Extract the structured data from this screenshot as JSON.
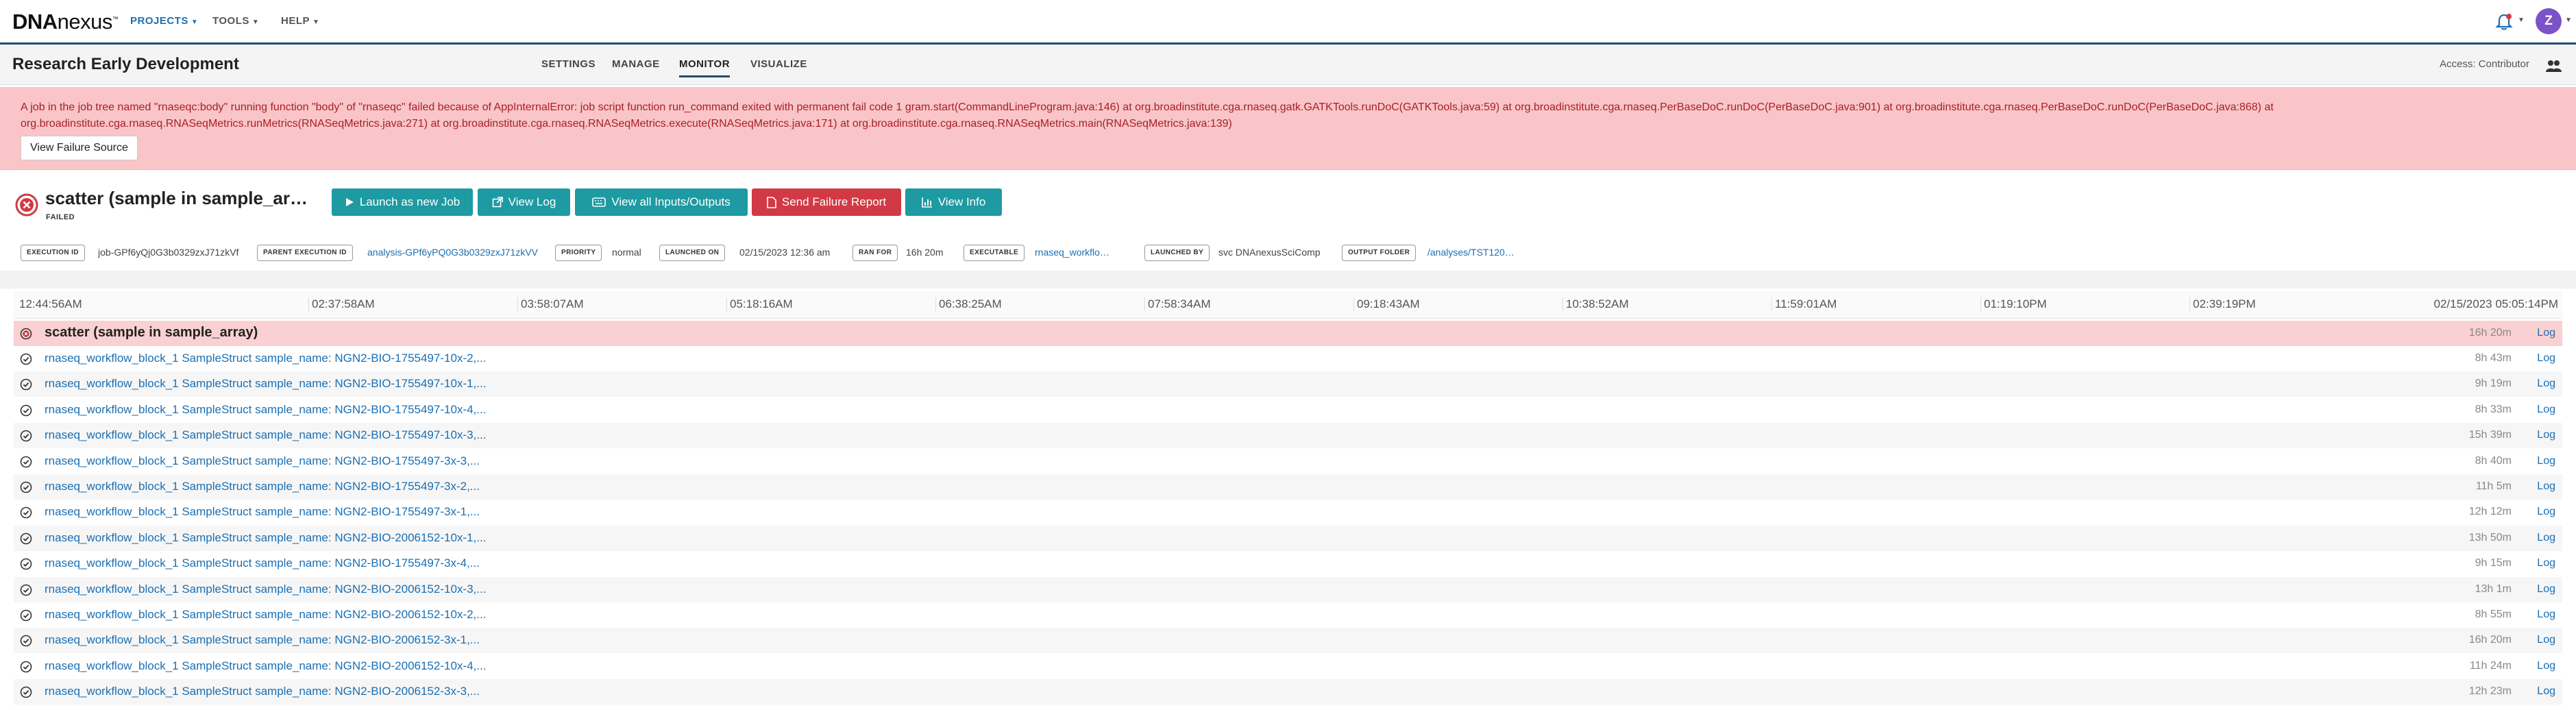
{
  "brand": {
    "logo_main": "DNA",
    "logo_rest": "nexus"
  },
  "nav": {
    "menus": [
      {
        "label": "PROJECTS",
        "active": true
      },
      {
        "label": "TOOLS",
        "active": false
      },
      {
        "label": "HELP",
        "active": false
      }
    ],
    "avatar_initial": "Z",
    "accent": "#1a6fb3"
  },
  "project": {
    "title": "Research Early Development",
    "tabs": [
      {
        "label": "SETTINGS"
      },
      {
        "label": "MANAGE"
      },
      {
        "label": "MONITOR",
        "active": true
      },
      {
        "label": "VISUALIZE"
      }
    ],
    "access": "Access: Contributor"
  },
  "error": {
    "message": "A job in the job tree named \"rnaseqc:body\" running function \"body\" of \"rnaseqc\" failed because of AppInternalError: job script function run_command exited with permanent fail code 1 gram.start(CommandLineProgram.java:146) at org.broadinstitute.cga.rnaseq.gatk.GATKTools.runDoC(GATKTools.java:59) at org.broadinstitute.cga.rnaseq.PerBaseDoC.runDoC(PerBaseDoC.java:901) at org.broadinstitute.cga.rnaseq.PerBaseDoC.runDoC(PerBaseDoC.java:868) at org.broadinstitute.cga.rnaseq.RNASeqMetrics.runMetrics(RNASeqMetrics.java:271) at org.broadinstitute.cga.rnaseq.RNASeqMetrics.execute(RNASeqMetrics.java:171) at org.broadinstitute.cga.rnaseq.RNASeqMetrics.main(RNASeqMetrics.java:139)",
    "button": "View Failure Source",
    "color": "#a81f26"
  },
  "job": {
    "name": "scatter (sample in sample_ar…",
    "status": "FAILED",
    "status_color": "#d13a44"
  },
  "actions": {
    "launch": "Launch as new Job",
    "view_log": "View Log",
    "view_io": "View all Inputs/Outputs",
    "send_report": "Send Failure Report",
    "view_info": "View Info"
  },
  "meta": [
    {
      "label": "EXECUTION ID",
      "value": "job-GPf6yQj0G3b0329zxJ71zkVf"
    },
    {
      "label": "PARENT EXECUTION ID",
      "value": "analysis-GPf6yPQ0G3b0329zxJ71zkVV"
    },
    {
      "label": "PRIORITY",
      "value": "normal"
    },
    {
      "label": "LAUNCHED ON",
      "value": "02/15/2023 12:36 am"
    },
    {
      "label": "RAN FOR",
      "value": "16h 20m"
    },
    {
      "label": "EXECUTABLE",
      "value": "rnaseq_workflo…"
    },
    {
      "label": "LAUNCHED BY",
      "value": "svc DNAnexusSciComp"
    },
    {
      "label": "OUTPUT FOLDER",
      "value": "/analyses/TST120…"
    }
  ],
  "timeline": {
    "ticks": [
      "12:44:56AM",
      "02:37:58AM",
      "03:58:07AM",
      "05:18:16AM",
      "06:38:25AM",
      "07:58:34AM",
      "09:18:43AM",
      "10:38:52AM",
      "11:59:01AM",
      "01:19:10PM",
      "02:39:19PM",
      "02/15/2023 05:05:14PM"
    ]
  },
  "parent_row": {
    "label": "scatter (sample in sample_array)",
    "duration": "16h 20m",
    "log": "Log"
  },
  "rows": [
    {
      "label": "rnaseq_workflow_block_1 SampleStruct sample_name: NGN2-BIO-1755497-10x-2,...",
      "duration": "8h 43m",
      "log": "Log"
    },
    {
      "label": "rnaseq_workflow_block_1 SampleStruct sample_name: NGN2-BIO-1755497-10x-1,...",
      "duration": "9h 19m",
      "log": "Log"
    },
    {
      "label": "rnaseq_workflow_block_1 SampleStruct sample_name: NGN2-BIO-1755497-10x-4,...",
      "duration": "8h 33m",
      "log": "Log"
    },
    {
      "label": "rnaseq_workflow_block_1 SampleStruct sample_name: NGN2-BIO-1755497-10x-3,...",
      "duration": "15h 39m",
      "log": "Log"
    },
    {
      "label": "rnaseq_workflow_block_1 SampleStruct sample_name: NGN2-BIO-1755497-3x-3,...",
      "duration": "8h 40m",
      "log": "Log"
    },
    {
      "label": "rnaseq_workflow_block_1 SampleStruct sample_name: NGN2-BIO-1755497-3x-2,...",
      "duration": "11h 5m",
      "log": "Log"
    },
    {
      "label": "rnaseq_workflow_block_1 SampleStruct sample_name: NGN2-BIO-1755497-3x-1,...",
      "duration": "12h 12m",
      "log": "Log"
    },
    {
      "label": "rnaseq_workflow_block_1 SampleStruct sample_name: NGN2-BIO-2006152-10x-1,...",
      "duration": "13h 50m",
      "log": "Log"
    },
    {
      "label": "rnaseq_workflow_block_1 SampleStruct sample_name: NGN2-BIO-1755497-3x-4,...",
      "duration": "9h 15m",
      "log": "Log"
    },
    {
      "label": "rnaseq_workflow_block_1 SampleStruct sample_name: NGN2-BIO-2006152-10x-3,...",
      "duration": "13h 1m",
      "log": "Log"
    },
    {
      "label": "rnaseq_workflow_block_1 SampleStruct sample_name: NGN2-BIO-2006152-10x-2,...",
      "duration": "8h 55m",
      "log": "Log"
    },
    {
      "label": "rnaseq_workflow_block_1 SampleStruct sample_name: NGN2-BIO-2006152-3x-1,...",
      "duration": "16h 20m",
      "log": "Log"
    },
    {
      "label": "rnaseq_workflow_block_1 SampleStruct sample_name: NGN2-BIO-2006152-10x-4,...",
      "duration": "11h 24m",
      "log": "Log"
    },
    {
      "label": "rnaseq_workflow_block_1 SampleStruct sample_name: NGN2-BIO-2006152-3x-3,...",
      "duration": "12h 23m",
      "log": "Log"
    }
  ]
}
